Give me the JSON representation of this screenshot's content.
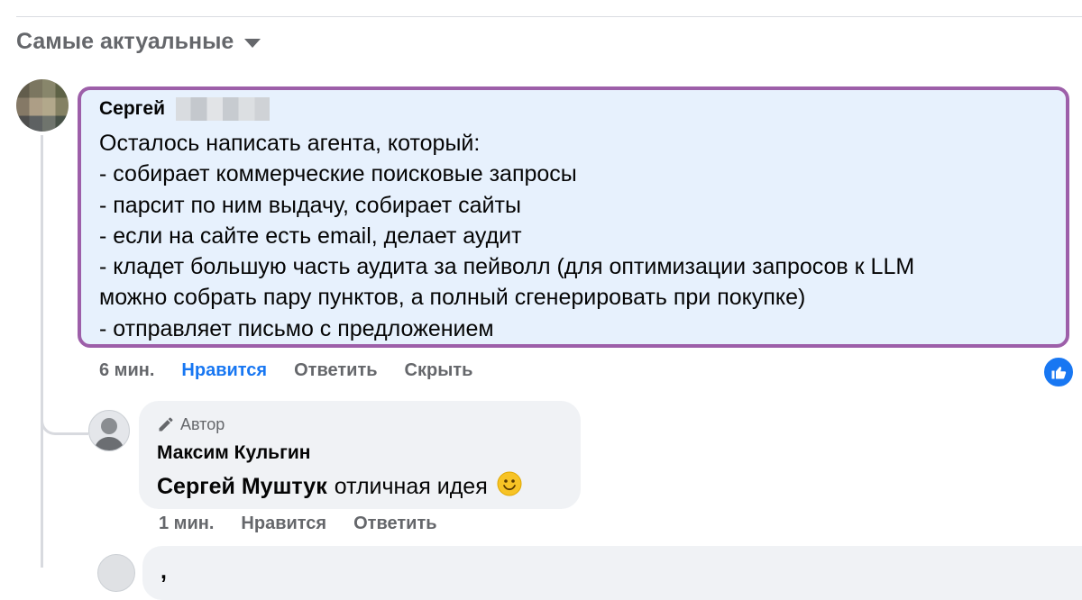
{
  "sort": {
    "label": "Самые актуальные",
    "icon": "caret-down-icon"
  },
  "comment": {
    "author": "Сергей",
    "lines": [
      "Осталось написать агента, который:",
      "- собирает коммерческие поисковые запросы",
      "- парсит по ним выдачу, собирает сайты",
      "- если на сайте есть email, делает аудит",
      "- кладет большую часть аудита за пейволл (для оптимизации запросов к LLM",
      "можно собрать пару пунктов, а полный сгенерировать при покупке)",
      "- отправляет письмо с предложением"
    ],
    "time": "6 мин.",
    "like": "Нравится",
    "reply": "Ответить",
    "hide": "Скрыть",
    "highlight_color": "#9d5fa9",
    "like_color": "#1877f2"
  },
  "reply": {
    "role": "Автор",
    "role_icon": "pencil-icon",
    "author": "Максим Кульгин",
    "mention": "Сергей Муштук",
    "text": "отличная идея",
    "emoji": "🙂",
    "time": "1 мин.",
    "like": "Нравится",
    "reply": "Ответить"
  }
}
